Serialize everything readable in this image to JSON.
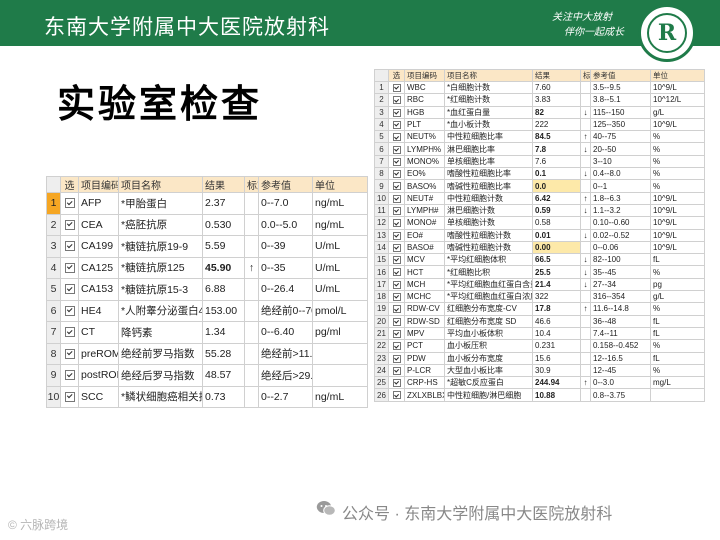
{
  "header": {
    "title": "东南大学附属中大医院放射科",
    "slogan_line1": "关注中大放射",
    "slogan_line2": "伴你一起成长",
    "logo_letter": "R",
    "bg_color": "#1f7b49"
  },
  "slide_title": "实验室检查",
  "left_table": {
    "headers": [
      "选",
      "项目编码",
      "项目名称",
      "结果",
      "标志",
      "参考值",
      "单位"
    ],
    "rows": [
      {
        "n": "1",
        "code": "AFP",
        "name": "*甲胎蛋白",
        "result": "2.37",
        "flag": "",
        "ref": "0--7.0",
        "unit": "ng/mL"
      },
      {
        "n": "2",
        "code": "CEA",
        "name": "*癌胚抗原",
        "result": "0.530",
        "flag": "",
        "ref": "0.0--5.0",
        "unit": "ng/mL"
      },
      {
        "n": "3",
        "code": "CA199",
        "name": "*糖链抗原19-9",
        "result": "5.59",
        "flag": "",
        "ref": "0--39",
        "unit": "U/mL"
      },
      {
        "n": "4",
        "code": "CA125",
        "name": "*糖链抗原125",
        "result": "45.90",
        "flag": "↑",
        "ref": "0--35",
        "unit": "U/mL"
      },
      {
        "n": "5",
        "code": "CA153",
        "name": "*糖链抗原15-3",
        "result": "6.88",
        "flag": "",
        "ref": "0--26.4",
        "unit": "U/mL"
      },
      {
        "n": "6",
        "code": "HE4",
        "name": "*人附睾分泌蛋白4",
        "result": "153.00",
        "flag": "",
        "ref": "绝经前0--70;",
        "unit": "pmol/L"
      },
      {
        "n": "7",
        "code": "CT",
        "name": "降钙素",
        "result": "1.34",
        "flag": "",
        "ref": "0--6.40",
        "unit": "pg/ml"
      },
      {
        "n": "8",
        "code": "preROMA",
        "name": "绝经前罗马指数",
        "result": "55.28",
        "flag": "",
        "ref": "绝经前>11.4 %",
        "unit": ""
      },
      {
        "n": "9",
        "code": "postROMA",
        "name": "绝经后罗马指数",
        "result": "48.57",
        "flag": "",
        "ref": "绝经后>29.9 %",
        "unit": ""
      },
      {
        "n": "10",
        "code": "SCC",
        "name": "*鳞状细胞癌相关抗原",
        "result": "0.73",
        "flag": "",
        "ref": "0--2.7",
        "unit": "ng/mL"
      }
    ]
  },
  "right_table": {
    "headers": [
      "选",
      "项目编码",
      "项目名称",
      "结果",
      "标志",
      "参考值",
      "单位"
    ],
    "rows": [
      {
        "n": "1",
        "code": "WBC",
        "name": "*白细胞计数",
        "result": "7.60",
        "flag": "",
        "ref": "3.5--9.5",
        "unit": "10^9/L"
      },
      {
        "n": "2",
        "code": "RBC",
        "name": "*红细胞计数",
        "result": "3.83",
        "flag": "",
        "ref": "3.8--5.1",
        "unit": "10^12/L"
      },
      {
        "n": "3",
        "code": "HGB",
        "name": "*血红蛋白量",
        "result": "82",
        "flag": "↓",
        "ref": "115--150",
        "unit": "g/L"
      },
      {
        "n": "4",
        "code": "PLT",
        "name": "*血小板计数",
        "result": "222",
        "flag": "",
        "ref": "125--350",
        "unit": "10^9/L"
      },
      {
        "n": "5",
        "code": "NEUT%",
        "name": "中性粒细胞比率",
        "result": "84.5",
        "flag": "↑",
        "ref": "40--75",
        "unit": "%"
      },
      {
        "n": "6",
        "code": "LYMPH%",
        "name": "淋巴细胞比率",
        "result": "7.8",
        "flag": "↓",
        "ref": "20--50",
        "unit": "%"
      },
      {
        "n": "7",
        "code": "MONO%",
        "name": "单核细胞比率",
        "result": "7.6",
        "flag": "",
        "ref": "3--10",
        "unit": "%"
      },
      {
        "n": "8",
        "code": "EO%",
        "name": "嗜酸性粒细胞比率",
        "result": "0.1",
        "flag": "↓",
        "ref": "0.4--8.0",
        "unit": "%"
      },
      {
        "n": "9",
        "code": "BASO%",
        "name": "嗜碱性粒细胞比率",
        "result": "0.0",
        "flag": "",
        "ref": "0--1",
        "unit": "%"
      },
      {
        "n": "10",
        "code": "NEUT#",
        "name": "中性粒细胞计数",
        "result": "6.42",
        "flag": "↑",
        "ref": "1.8--6.3",
        "unit": "10^9/L"
      },
      {
        "n": "11",
        "code": "LYMPH#",
        "name": "淋巴细胞计数",
        "result": "0.59",
        "flag": "↓",
        "ref": "1.1--3.2",
        "unit": "10^9/L"
      },
      {
        "n": "12",
        "code": "MONO#",
        "name": "单核细胞计数",
        "result": "0.58",
        "flag": "",
        "ref": "0.10--0.60",
        "unit": "10^9/L"
      },
      {
        "n": "13",
        "code": "EO#",
        "name": "嗜酸性粒细胞计数",
        "result": "0.01",
        "flag": "↓",
        "ref": "0.02--0.52",
        "unit": "10^9/L"
      },
      {
        "n": "14",
        "code": "BASO#",
        "name": "嗜碱性粒细胞计数",
        "result": "0.00",
        "flag": "",
        "ref": "0--0.06",
        "unit": "10^9/L"
      },
      {
        "n": "15",
        "code": "MCV",
        "name": "*平均红细胞体积",
        "result": "66.5",
        "flag": "↓",
        "ref": "82--100",
        "unit": "fL"
      },
      {
        "n": "16",
        "code": "HCT",
        "name": "*红细胞比积",
        "result": "25.5",
        "flag": "↓",
        "ref": "35--45",
        "unit": "%"
      },
      {
        "n": "17",
        "code": "MCH",
        "name": "*平均红细胞血红蛋白含量",
        "result": "21.4",
        "flag": "↓",
        "ref": "27--34",
        "unit": "pg"
      },
      {
        "n": "18",
        "code": "MCHC",
        "name": "*平均红细胞血红蛋白浓度",
        "result": "322",
        "flag": "",
        "ref": "316--354",
        "unit": "g/L"
      },
      {
        "n": "19",
        "code": "RDW-CV",
        "name": "红细胞分布宽度-CV",
        "result": "17.8",
        "flag": "↑",
        "ref": "11.6--14.8",
        "unit": "%"
      },
      {
        "n": "20",
        "code": "RDW-SD",
        "name": "红细胞分布宽度 SD",
        "result": "46.6",
        "flag": "",
        "ref": "36--48",
        "unit": "fL"
      },
      {
        "n": "21",
        "code": "MPV",
        "name": "平均血小板体积",
        "result": "10.4",
        "flag": "",
        "ref": "7.4--11",
        "unit": "fL"
      },
      {
        "n": "22",
        "code": "PCT",
        "name": "血小板压积",
        "result": "0.231",
        "flag": "",
        "ref": "0.158--0.452",
        "unit": "%"
      },
      {
        "n": "23",
        "code": "PDW",
        "name": "血小板分布宽度",
        "result": "15.6",
        "flag": "",
        "ref": "12--16.5",
        "unit": "fL"
      },
      {
        "n": "24",
        "code": "P-LCR",
        "name": "大型血小板比率",
        "result": "30.9",
        "flag": "",
        "ref": "12--45",
        "unit": "%"
      },
      {
        "n": "25",
        "code": "CRP-HS",
        "name": "*超敏C反应蛋白",
        "result": "244.94",
        "flag": "↑",
        "ref": "0--3.0",
        "unit": "mg/L"
      },
      {
        "n": "26",
        "code": "ZXLXBLBX",
        "name": "中性粒细胞/淋巴细胞",
        "result": "10.88",
        "flag": "",
        "ref": "0.8--3.75",
        "unit": ""
      }
    ]
  },
  "footer": {
    "watermark": "公众号 · 东南大学附属中大医院放射科",
    "corner": "© 六脉跨境"
  }
}
